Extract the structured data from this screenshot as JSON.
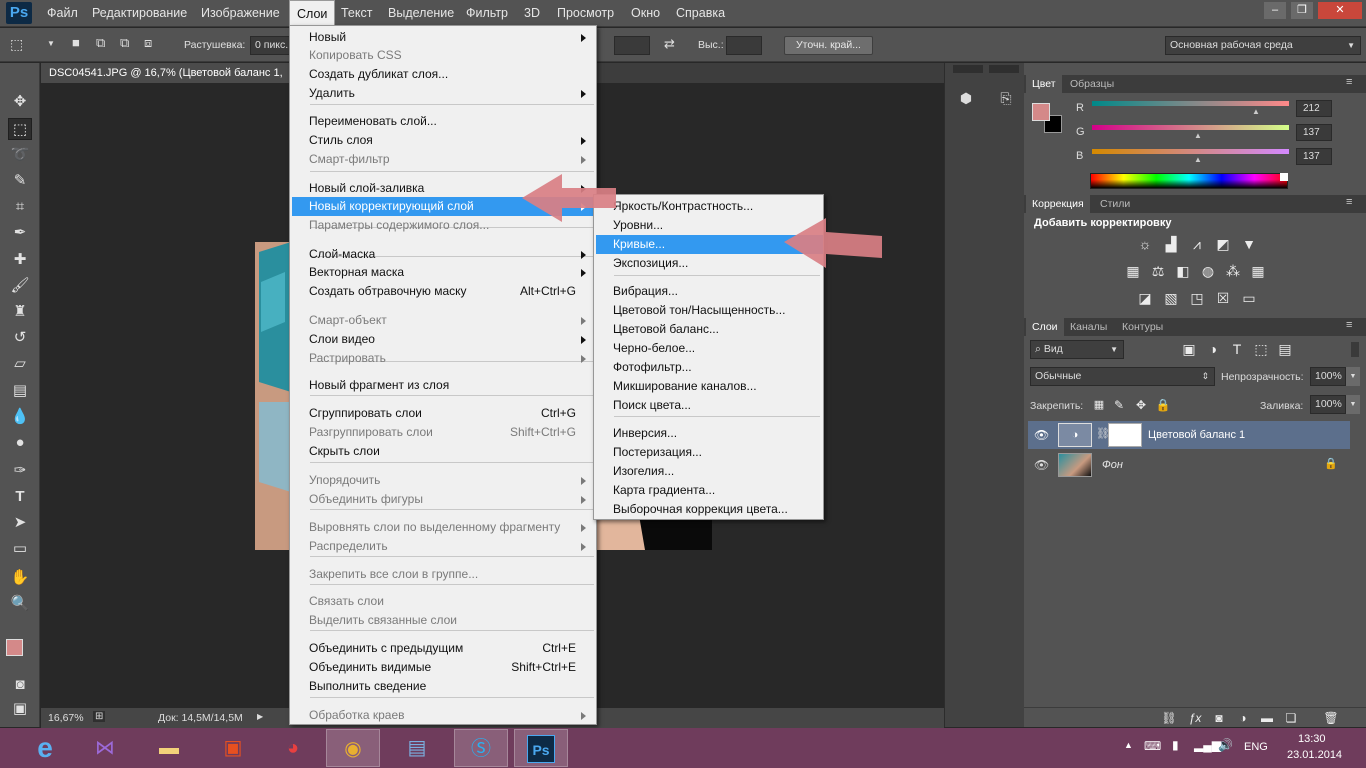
{
  "app": {
    "logo": "Ps"
  },
  "menubar": {
    "items": [
      "Файл",
      "Редактирование",
      "Изображение",
      "Слои",
      "Текст",
      "Выделение",
      "Фильтр",
      "3D",
      "Просмотр",
      "Окно",
      "Справка"
    ],
    "active": "Слои"
  },
  "options": {
    "feather_label": "Растушевка:",
    "feather_value": "0 пикс.",
    "height_label": "Выс.:",
    "refine_edge": "Уточн. край...",
    "workspace": "Основная рабочая среда"
  },
  "document": {
    "tab_title": "DSC04541.JPG @ 16,7% (Цветовой баланс 1,",
    "zoom": "16,67%",
    "doc_info": "Док: 14,5M/14,5M"
  },
  "layer_menu": [
    {
      "label": "Новый",
      "arrow": true
    },
    {
      "label": "Копировать CSS",
      "disabled": true
    },
    {
      "label": "Создать дубликат слоя..."
    },
    {
      "label": "Удалить",
      "arrow": true
    },
    {
      "label": "Переименовать слой..."
    },
    {
      "label": "Стиль слоя",
      "arrow": true
    },
    {
      "label": "Смарт-фильтр",
      "disabled": true,
      "arrow": true
    },
    {
      "label": "Новый слой-заливка",
      "arrow": true
    },
    {
      "label": "Новый корректирующий слой",
      "arrow": true,
      "highlighted": true
    },
    {
      "label": "Параметры содержимого слоя...",
      "disabled": true
    },
    {
      "label": "Слой-маска",
      "arrow": true
    },
    {
      "label": "Векторная маска",
      "arrow": true
    },
    {
      "label": "Создать обтравочную маску",
      "shortcut": "Alt+Ctrl+G"
    },
    {
      "label": "Смарт-объект",
      "disabled": true,
      "arrow": true
    },
    {
      "label": "Слои видео",
      "arrow": true
    },
    {
      "label": "Растрировать",
      "disabled": true,
      "arrow": true
    },
    {
      "label": "Новый фрагмент из слоя"
    },
    {
      "label": "Сгруппировать слои",
      "shortcut": "Ctrl+G"
    },
    {
      "label": "Разгруппировать слои",
      "shortcut": "Shift+Ctrl+G",
      "disabled": true
    },
    {
      "label": "Скрыть слои"
    },
    {
      "label": "Упорядочить",
      "disabled": true,
      "arrow": true
    },
    {
      "label": "Объединить фигуры",
      "disabled": true,
      "arrow": true
    },
    {
      "label": "Выровнять слои по выделенному фрагменту",
      "disabled": true,
      "arrow": true
    },
    {
      "label": "Распределить",
      "disabled": true,
      "arrow": true
    },
    {
      "label": "Закрепить все слои в группе...",
      "disabled": true
    },
    {
      "label": "Связать слои",
      "disabled": true
    },
    {
      "label": "Выделить связанные слои",
      "disabled": true
    },
    {
      "label": "Объединить с предыдущим",
      "shortcut": "Ctrl+E"
    },
    {
      "label": "Объединить видимые",
      "shortcut": "Shift+Ctrl+E"
    },
    {
      "label": "Выполнить сведение"
    },
    {
      "label": "Обработка краев",
      "disabled": true,
      "arrow": true
    }
  ],
  "adjustment_submenu": [
    {
      "label": "Яркость/Контрастность..."
    },
    {
      "label": "Уровни..."
    },
    {
      "label": "Кривые...",
      "highlighted": true
    },
    {
      "label": "Экспозиция..."
    },
    {
      "label": "Вибрация..."
    },
    {
      "label": "Цветовой тон/Насыщенность..."
    },
    {
      "label": "Цветовой баланс..."
    },
    {
      "label": "Черно-белое..."
    },
    {
      "label": "Фотофильтр..."
    },
    {
      "label": "Микширование каналов..."
    },
    {
      "label": "Поиск цвета..."
    },
    {
      "label": "Инверсия..."
    },
    {
      "label": "Постеризация..."
    },
    {
      "label": "Изогелия..."
    },
    {
      "label": "Карта градиента..."
    },
    {
      "label": "Выборочная коррекция цвета..."
    }
  ],
  "color_panel": {
    "tabs": [
      "Цвет",
      "Образцы"
    ],
    "channels": [
      {
        "name": "R",
        "value": "212"
      },
      {
        "name": "G",
        "value": "137"
      },
      {
        "name": "B",
        "value": "137"
      }
    ],
    "foreground": "#d48989"
  },
  "adjustments_panel": {
    "tabs": [
      "Коррекция",
      "Стили"
    ],
    "heading": "Добавить корректировку"
  },
  "layers_panel": {
    "tabs": [
      "Слои",
      "Каналы",
      "Контуры"
    ],
    "filter": "Вид",
    "blend_mode": "Обычные",
    "opacity_label": "Непрозрачность:",
    "opacity": "100%",
    "lock_label": "Закрепить:",
    "fill_label": "Заливка:",
    "fill": "100%",
    "layers": [
      {
        "name": "Цветовой баланс 1",
        "selected": true
      },
      {
        "name": "Фон",
        "locked": true
      }
    ]
  },
  "taskbar": {
    "language": "ENG",
    "time": "13:30",
    "date": "23.01.2014"
  }
}
